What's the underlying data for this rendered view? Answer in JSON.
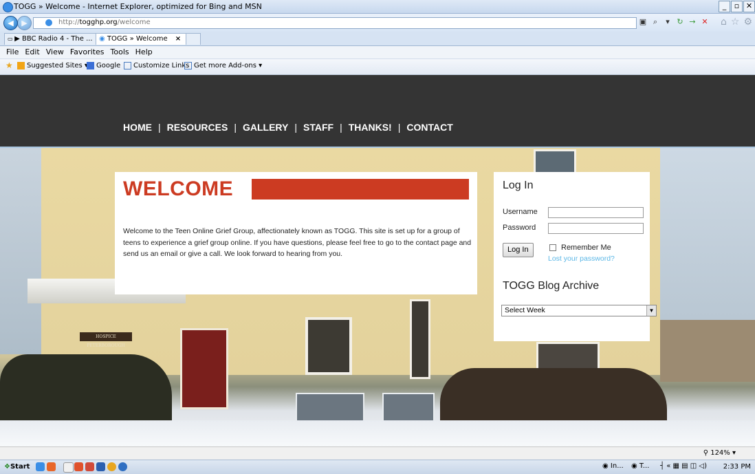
{
  "window": {
    "title": "TOGG » Welcome - Internet Explorer, optimized for Bing and MSN",
    "buttons": [
      "_",
      "á",
      "X"
    ]
  },
  "address": {
    "url_prefix": "http://",
    "url_domain": "togghp.org",
    "url_path": "/welcome"
  },
  "tabs": [
    {
      "label": "▶ BBC Radio 4 - The ..."
    },
    {
      "label": "TOGG » Welcome"
    }
  ],
  "tab_close": "×",
  "menu": [
    "File",
    "Edit",
    "View",
    "Favorites",
    "Tools",
    "Help"
  ],
  "favorites": [
    {
      "label": "Suggested Sites ▾"
    },
    {
      "label": "Google"
    },
    {
      "label": "Customize Links"
    },
    {
      "label": "Get more Add-ons ▾"
    }
  ],
  "site": {
    "nav": [
      "HOME",
      "RESOURCES",
      "GALLERY",
      "STAFF",
      "THANKS!",
      "CONTACT"
    ],
    "nav_separator": "|",
    "sign_text": "HOSPICE PETERBOROUGH",
    "welcome": {
      "title": "WELCOME",
      "body": "Welcome to the Teen Online Grief Group, affectionately known as TOGG. This site is set up for a group of teens to experience a grief group online. If you have questions, please feel free to go to the contact page and send us an email or give a call. We look forward to hearing from you."
    },
    "login": {
      "heading": "Log In",
      "username_label": "Username",
      "password_label": "Password",
      "button": "Log In",
      "remember": "Remember Me",
      "lost": "Lost your password?"
    },
    "archive": {
      "heading": "TOGG Blog Archive",
      "selected": "Select Week"
    }
  },
  "status": {
    "zoom": "124%"
  },
  "taskbar": {
    "start": "Start",
    "items": [
      "In...",
      "T..."
    ],
    "clock": "2:33 PM"
  }
}
